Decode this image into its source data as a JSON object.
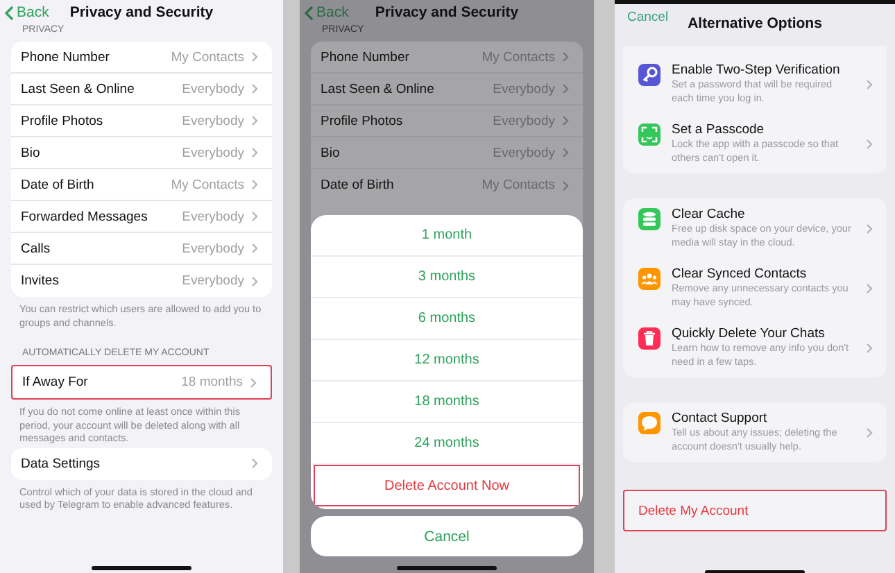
{
  "panels": [
    {
      "kind": "settings",
      "dimmed": false,
      "nav": {
        "back": "Back",
        "title": "Privacy and Security"
      },
      "sections": [
        {
          "header": "PRIVACY",
          "rows": [
            {
              "label": "Phone Number",
              "value": "My Contacts",
              "highlighted": false
            },
            {
              "label": "Last Seen & Online",
              "value": "Everybody",
              "highlighted": false
            },
            {
              "label": "Profile Photos",
              "value": "Everybody",
              "highlighted": false
            },
            {
              "label": "Bio",
              "value": "Everybody",
              "highlighted": false
            },
            {
              "label": "Date of Birth",
              "value": "My Contacts",
              "highlighted": false
            },
            {
              "label": "Forwarded Messages",
              "value": "Everybody",
              "highlighted": false
            },
            {
              "label": "Calls",
              "value": "Everybody",
              "highlighted": false
            },
            {
              "label": "Invites",
              "value": "Everybody",
              "highlighted": false
            }
          ],
          "footer": "You can restrict which users are allowed to add you to groups and channels."
        },
        {
          "header": "AUTOMATICALLY DELETE MY ACCOUNT",
          "rows": [
            {
              "label": "If Away For",
              "value": "18 months",
              "highlighted": true
            }
          ],
          "footer": "If you do not come online at least once within this period, your account will be deleted along with all messages and contacts."
        },
        {
          "rows": [
            {
              "label": "Data Settings",
              "highlighted": false
            }
          ],
          "footer": "Control which of your data is stored in the cloud and used by Telegram to enable advanced features."
        }
      ]
    },
    {
      "kind": "settings",
      "dimmed": true,
      "nav": {
        "back": "Back",
        "title": "Privacy and Security"
      },
      "sections": [
        {
          "header": "PRIVACY",
          "rows": [
            {
              "label": "Phone Number",
              "value": "My Contacts",
              "highlighted": false
            },
            {
              "label": "Last Seen & Online",
              "value": "Everybody",
              "highlighted": false
            },
            {
              "label": "Profile Photos",
              "value": "Everybody",
              "highlighted": false
            },
            {
              "label": "Bio",
              "value": "Everybody",
              "highlighted": false
            },
            {
              "label": "Date of Birth",
              "value": "My Contacts",
              "highlighted": false
            }
          ]
        }
      ],
      "sheet": {
        "options": [
          {
            "label": "1 month",
            "kind": "option",
            "highlighted": false
          },
          {
            "label": "3 months",
            "kind": "option",
            "highlighted": false
          },
          {
            "label": "6 months",
            "kind": "option",
            "highlighted": false
          },
          {
            "label": "12 months",
            "kind": "option",
            "highlighted": false
          },
          {
            "label": "18 months",
            "kind": "option",
            "highlighted": false
          },
          {
            "label": "24 months",
            "kind": "option",
            "highlighted": false
          },
          {
            "label": "Delete Account Now",
            "kind": "destructive",
            "highlighted": true
          }
        ],
        "cancel": "Cancel"
      }
    },
    {
      "kind": "options",
      "nav": {
        "cancel": "Cancel",
        "title": "Alternative Options"
      },
      "groups": [
        {
          "items": [
            {
              "kind": "key",
              "color": "#5856d6",
              "title": "Enable Two-Step Verification",
              "subtitle": "Set a password that will be required each time you log in."
            },
            {
              "kind": "scan",
              "color": "#34c759",
              "title": "Set a Passcode",
              "subtitle": "Lock the app with a passcode so that others can't open it."
            }
          ]
        },
        {
          "items": [
            {
              "kind": "database",
              "color": "#34c759",
              "title": "Clear Cache",
              "subtitle": "Free up disk space on your device, your media will stay in the cloud."
            },
            {
              "kind": "people",
              "color": "#ff9500",
              "title": "Clear Synced Contacts",
              "subtitle": "Remove any unnecessary contacts you may have synced."
            },
            {
              "kind": "trash",
              "color": "#ff2d55",
              "title": "Quickly Delete Your Chats",
              "subtitle": "Learn how to remove any info you don't need in a few taps."
            }
          ]
        },
        {
          "items": [
            {
              "kind": "chat",
              "color": "#ff9500",
              "title": "Contact Support",
              "subtitle": "Tell us about any issues; deleting the account doesn't usually help."
            }
          ]
        }
      ],
      "delete": {
        "label": "Delete My Account",
        "highlighted": true
      }
    }
  ]
}
